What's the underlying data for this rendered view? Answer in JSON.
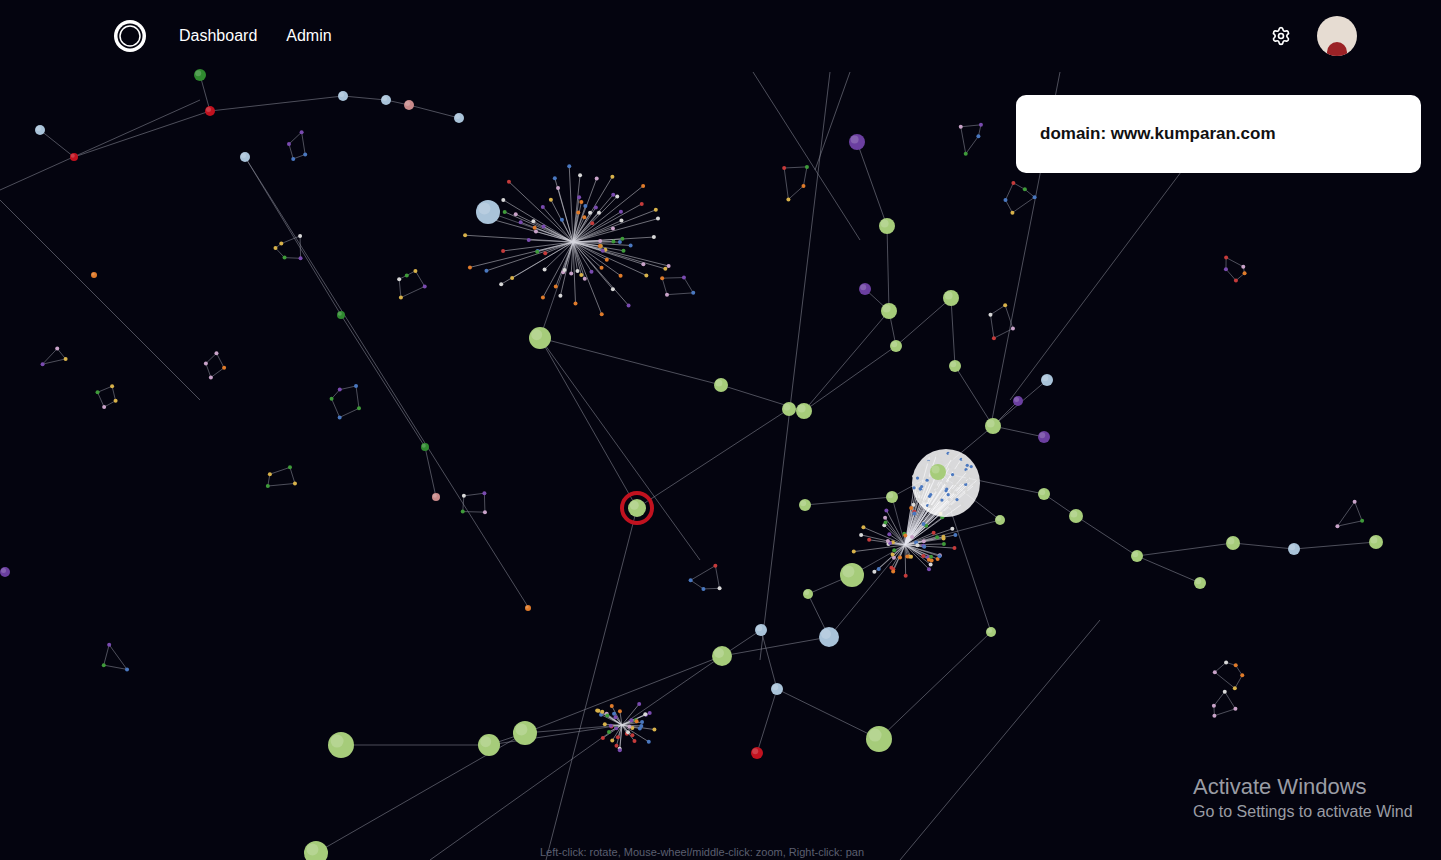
{
  "nav": {
    "items": [
      {
        "label": "Dashboard"
      },
      {
        "label": "Admin"
      }
    ]
  },
  "tooltip": {
    "text": "domain: www.kumparan.com"
  },
  "watermark": {
    "title": "Activate Windows",
    "subtitle": "Go to Settings to activate Wind"
  },
  "hint": "Left-click: rotate, Mouse-wheel/middle-click: zoom, Right-click: pan",
  "graph": {
    "small_node_colors": [
      "#e07b2a",
      "#3f9b3a",
      "#7a4bb0",
      "#c9a3c9",
      "#d8d8d8",
      "#d8b24a",
      "#4a78c0",
      "#c53b3b"
    ],
    "nodes": [
      {
        "color": "#a6cc7a",
        "selected": false
      },
      {
        "color": "#a6cc7a",
        "selected": false
      },
      {
        "color": "#a6cc7a",
        "selected": false
      },
      {
        "color": "#a6cc7a",
        "selected": false
      },
      {
        "color": "#a6cc7a",
        "selected": false
      },
      {
        "color": "#a6cc7a",
        "selected": false
      },
      {
        "color": "#a6cc7a",
        "selected": false
      },
      {
        "color": "#a6cc7a",
        "selected": false
      },
      {
        "color": "#a6cc7a",
        "selected": false
      },
      {
        "color": "#a6cc7a",
        "selected": false
      },
      {
        "color": "#a6cc7a",
        "selected": false
      },
      {
        "color": "#a6cc7a",
        "selected": false
      },
      {
        "color": "#a6cc7a",
        "selected": false
      },
      {
        "color": "#a6cc7a",
        "selected": false
      },
      {
        "color": "#a6cc7a",
        "selected": false
      },
      {
        "color": "#a6cc7a",
        "selected": false
      },
      {
        "color": "#a6cc7a",
        "selected": false
      },
      {
        "color": "#a6cc7a",
        "selected": false
      },
      {
        "color": "#a6cc7a",
        "selected": false
      },
      {
        "color": "#a6cc7a",
        "selected": false
      },
      {
        "color": "#a6cc7a",
        "selected": false
      },
      {
        "color": "#a6cc7a",
        "selected": false
      },
      {
        "color": "#a6cc7a",
        "selected": false
      },
      {
        "color": "#a6cc7a",
        "selected": false
      },
      {
        "color": "#a6cc7a",
        "selected": false
      },
      {
        "color": "#a6cc7a",
        "selected": false
      },
      {
        "color": "#a6cc7a",
        "selected": false
      },
      {
        "color": "#a6cc7a",
        "selected": false
      },
      {
        "color": "#a6cc7a",
        "selected": false
      },
      {
        "color": "#a6cc7a",
        "selected": true
      },
      {
        "color": "#a9c3d9",
        "selected": false
      },
      {
        "color": "#a9c3d9",
        "selected": false
      },
      {
        "color": "#a9c3d9",
        "selected": false
      },
      {
        "color": "#a9c3d9",
        "selected": false
      },
      {
        "color": "#a9c3d9",
        "selected": false
      },
      {
        "color": "#a9c3d9",
        "selected": false
      },
      {
        "color": "#a9c3d9",
        "selected": false
      },
      {
        "color": "#a9c3d9",
        "selected": false
      },
      {
        "color": "#a9c3d9",
        "selected": false
      },
      {
        "color": "#a9c3d9",
        "selected": false
      },
      {
        "color": "#a9c3d9",
        "selected": false
      },
      {
        "color": "#6b3fa0",
        "selected": false
      },
      {
        "color": "#6b3fa0",
        "selected": false
      },
      {
        "color": "#6b3fa0",
        "selected": false
      },
      {
        "color": "#6b3fa0",
        "selected": false
      },
      {
        "color": "#6b3fa0",
        "selected": false
      },
      {
        "color": "#c1121f",
        "selected": false
      },
      {
        "color": "#c1121f",
        "selected": false
      },
      {
        "color": "#c1121f",
        "selected": false
      },
      {
        "color": "#c98a8a",
        "selected": false
      },
      {
        "color": "#c98a8a",
        "selected": false
      },
      {
        "color": "#2f8a2f",
        "selected": false
      },
      {
        "color": "#2f8a2f",
        "selected": false
      },
      {
        "color": "#2f8a2f",
        "selected": false
      },
      {
        "color": "#e07b2a",
        "selected": false
      },
      {
        "color": "#e07b2a",
        "selected": false
      }
    ]
  }
}
